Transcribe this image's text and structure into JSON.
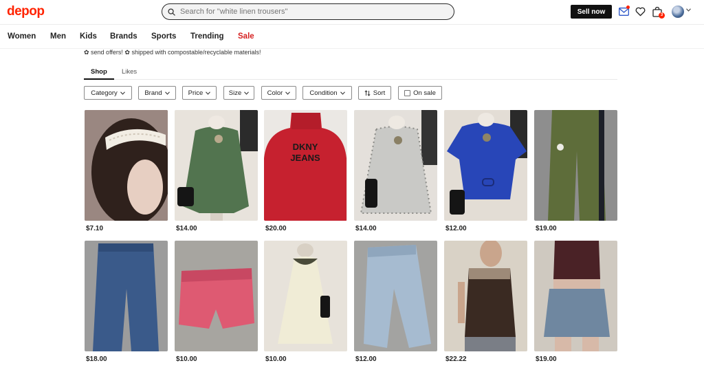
{
  "header": {
    "logo": "depop",
    "search_placeholder": "Search for \"white linen trousers\"",
    "sell_label": "Sell now",
    "basket_count": "3"
  },
  "nav": [
    "Women",
    "Men",
    "Kids",
    "Brands",
    "Sports",
    "Trending",
    "Sale"
  ],
  "bio": "✿ send offers! ✿ shipped with compostable/recyclable materials!",
  "tabs": [
    "Shop",
    "Likes"
  ],
  "filters": [
    "Category",
    "Brand",
    "Price",
    "Size",
    "Color",
    "Condition",
    "Sort",
    "On sale"
  ],
  "products": [
    {
      "price": "$7.10",
      "item": "lace headband"
    },
    {
      "price": "$14.00",
      "item": "green knit top"
    },
    {
      "price": "$20.00",
      "item": "red DKNY Jeans turtleneck"
    },
    {
      "price": "$14.00",
      "item": "floral print blouse"
    },
    {
      "price": "$12.00",
      "item": "blue button shirt"
    },
    {
      "price": "$19.00",
      "item": "olive track pants"
    },
    {
      "price": "$18.00",
      "item": "blue jeans"
    },
    {
      "price": "$10.00",
      "item": "pink shorts"
    },
    {
      "price": "$10.00",
      "item": "cream sleeveless dress"
    },
    {
      "price": "$12.00",
      "item": "light wash jeans"
    },
    {
      "price": "$22.22",
      "item": "brown fringe top"
    },
    {
      "price": "$19.00",
      "item": "denim mini skirt"
    }
  ],
  "colors": {
    "brand": "#ff2300",
    "sale": "#d51f1f",
    "dark": "#111111"
  }
}
